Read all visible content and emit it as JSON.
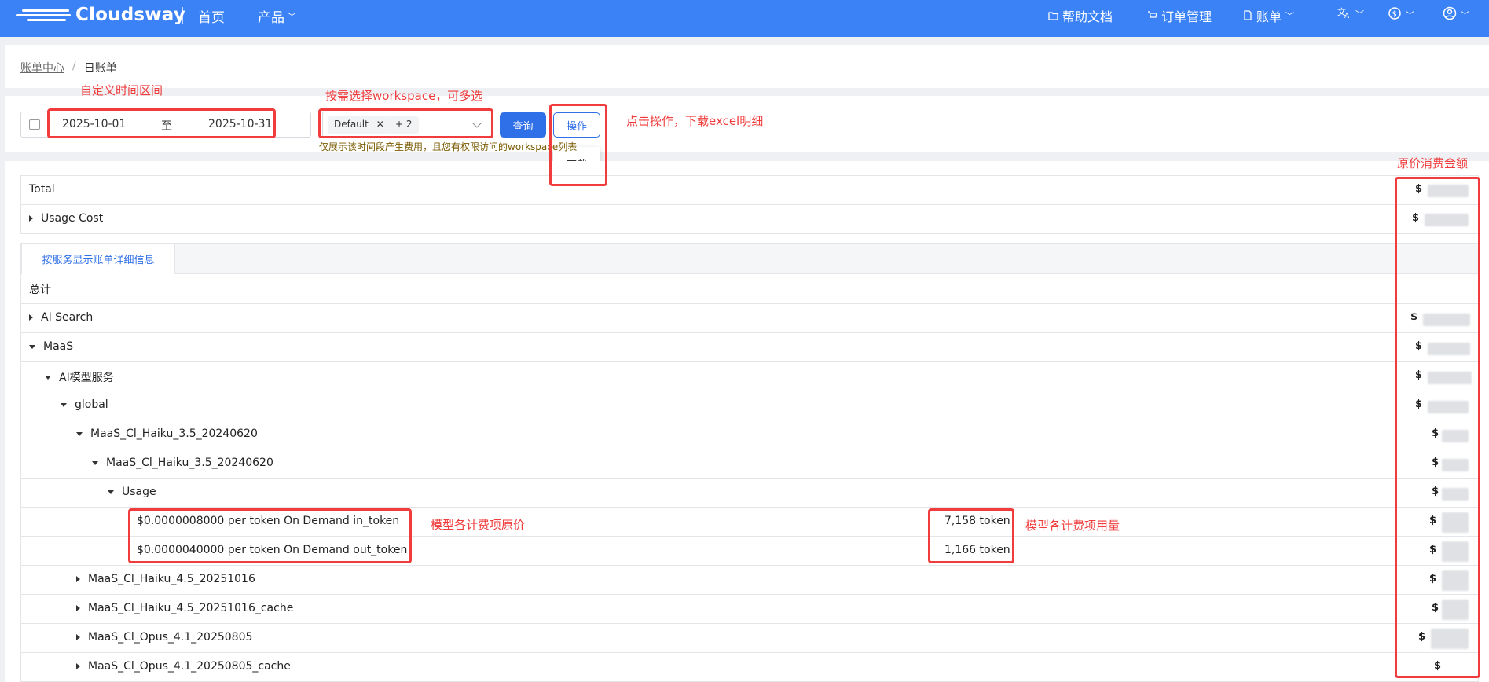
{
  "header": {
    "brand": "Cloudsway",
    "nav": [
      "首页",
      "产品"
    ],
    "right": [
      "帮助文档",
      "订单管理",
      "账单"
    ]
  },
  "breadcrumb": {
    "parent": "账单中心",
    "sep": "/",
    "current": "日账单"
  },
  "filters": {
    "date_start": "2025-10-01",
    "date_to": "至",
    "date_end": "2025-10-31",
    "ws_tag": "Default",
    "ws_more": "+ 2",
    "query_label": "查询",
    "op_label": "操作",
    "download_label": "下载",
    "hint": "仅展示该时间段产生费用，且您有权限访问的workspace列表"
  },
  "annotations": {
    "date_range": "自定义时间区间",
    "workspace": "按需选择workspace，可多选",
    "operation": "点击操作，下载excel明细",
    "original_amount": "原价消费金额",
    "unit_price": "模型各计费项原价",
    "usage_amount": "模型各计费项用量"
  },
  "table": {
    "total_label": "Total",
    "usage_cost_label": "Usage Cost",
    "tab_label": "按服务显示账单详细信息",
    "subtotal_label": "总计",
    "currency": "$",
    "rows": [
      "AI Search",
      "MaaS",
      "AI模型服务",
      "global",
      "MaaS_Cl_Haiku_3.5_20240620",
      "MaaS_Cl_Haiku_3.5_20240620",
      "Usage",
      "$0.0000008000 per token On Demand in_token",
      "$0.0000040000 per token On Demand out_token",
      "MaaS_Cl_Haiku_4.5_20251016",
      "MaaS_Cl_Haiku_4.5_20251016_cache",
      "MaaS_Cl_Opus_4.1_20250805",
      "MaaS_Cl_Opus_4.1_20250805_cache"
    ],
    "usage": [
      "7,158 token",
      "1,166 token"
    ]
  }
}
